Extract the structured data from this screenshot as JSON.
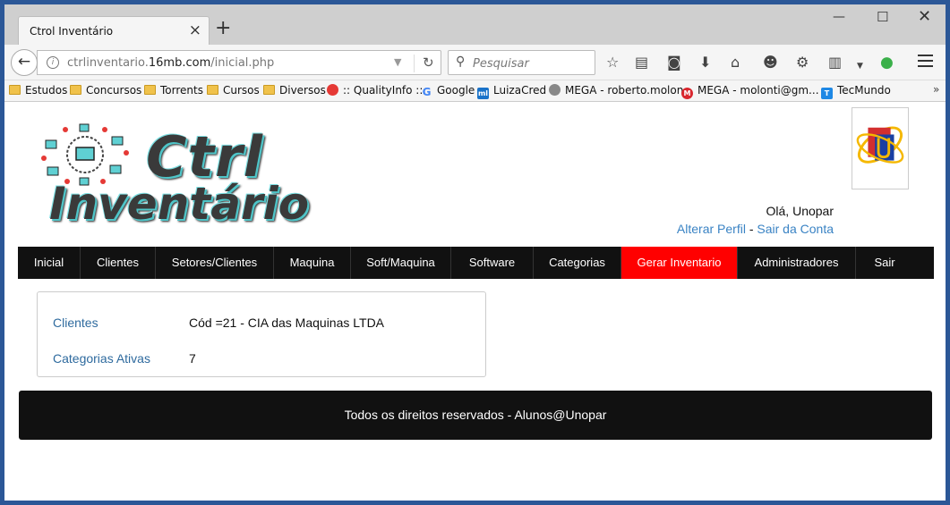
{
  "browser": {
    "tab_title": "Ctrol Inventário",
    "url_prefix": "ctrlinventario.",
    "url_domain": "16mb.com",
    "url_path": "/inicial.php",
    "search_placeholder": "Pesquisar"
  },
  "bookmarks": [
    {
      "label": "Estudos",
      "icon": "folder-icon"
    },
    {
      "label": "Concursos",
      "icon": "folder-icon"
    },
    {
      "label": "Torrents",
      "icon": "folder-icon"
    },
    {
      "label": "Cursos",
      "icon": "folder-icon"
    },
    {
      "label": "Diversos",
      "icon": "folder-icon"
    },
    {
      "label": ":: QualityInfo ::",
      "icon": "qualityinfo-icon"
    },
    {
      "label": "Google",
      "icon": "google-icon"
    },
    {
      "label": "LuizaCred",
      "icon": "luizacred-icon"
    },
    {
      "label": "MEGA - roberto.molon",
      "icon": "globe-icon"
    },
    {
      "label": "MEGA - molonti@gm...",
      "icon": "mega-icon"
    },
    {
      "label": "TecMundo",
      "icon": "tecmundo-icon"
    }
  ],
  "header": {
    "logo_line1": "Ctrl",
    "logo_line2": "Inventário",
    "greeting": "Olá, Unopar",
    "edit_profile": "Alterar Perfil",
    "separator": " - ",
    "logout": "Sair da Conta"
  },
  "menu": [
    {
      "label": "Inicial",
      "active": false
    },
    {
      "label": "Clientes",
      "active": false
    },
    {
      "label": "Setores/Clientes",
      "active": false
    },
    {
      "label": "Maquina",
      "active": false
    },
    {
      "label": "Soft/Maquina",
      "active": false
    },
    {
      "label": "Software",
      "active": false
    },
    {
      "label": "Categorias",
      "active": false
    },
    {
      "label": "Gerar Inventario",
      "active": true
    },
    {
      "label": "Administradores",
      "active": false
    },
    {
      "label": "Sair",
      "active": false
    }
  ],
  "info": {
    "clients_label": "Clientes",
    "clients_value": "Cód =21 - CIA das Maquinas LTDA",
    "categories_label": "Categorias Ativas",
    "categories_value": "7"
  },
  "footer": {
    "text": "Todos os direitos reservados - Alunos@Unopar"
  },
  "colors": {
    "menu_bg": "#111111",
    "menu_active": "#ff0000",
    "link": "#3a83c4",
    "label": "#2e6a9e"
  }
}
